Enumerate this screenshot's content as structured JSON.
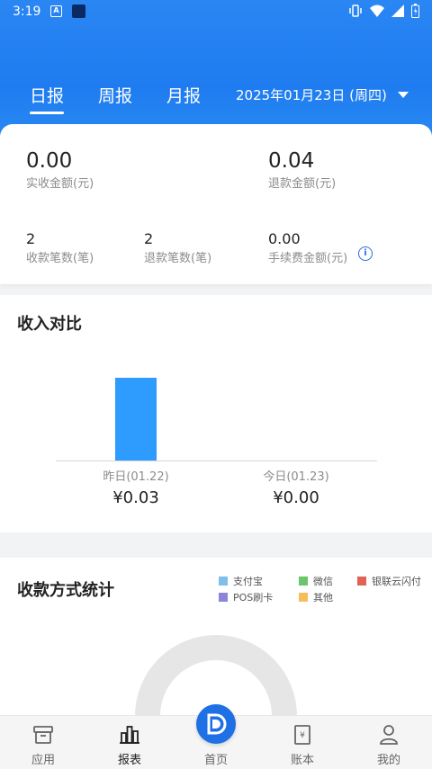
{
  "status": {
    "time": "3:19"
  },
  "tabs": [
    {
      "label": "日报",
      "active": true
    },
    {
      "label": "周报",
      "active": false
    },
    {
      "label": "月报",
      "active": false
    }
  ],
  "date": "2025年01月23日 (周四)",
  "summary": {
    "received_amount": {
      "value": "0.00",
      "label": "实收金额(元)"
    },
    "refund_amount": {
      "value": "0.04",
      "label": "退款金额(元)"
    },
    "received_count": {
      "value": "2",
      "label": "收款笔数(笔)"
    },
    "refund_count": {
      "value": "2",
      "label": "退款笔数(笔)"
    },
    "fee_amount": {
      "value": "0.00",
      "label": "手续费金额(元)"
    }
  },
  "income_compare": {
    "title": "收入对比",
    "yesterday": {
      "label": "昨日(01.22)",
      "amount": "¥0.03"
    },
    "today": {
      "label": "今日(01.23)",
      "amount": "¥0.00"
    }
  },
  "chart_data": {
    "type": "bar",
    "categories": [
      "昨日(01.22)",
      "今日(01.23)"
    ],
    "values": [
      0.03,
      0.0
    ]
  },
  "payment_stats": {
    "title": "收款方式统计",
    "legend": [
      {
        "name": "支付宝",
        "color": "#7fbfe9"
      },
      {
        "name": "微信",
        "color": "#6cc46c"
      },
      {
        "name": "银联云闪付",
        "color": "#e06356"
      },
      {
        "name": "POS刷卡",
        "color": "#8a85d8"
      },
      {
        "name": "其他",
        "color": "#f5be5b"
      }
    ]
  },
  "nav": [
    {
      "label": "应用",
      "icon": "app-box-icon"
    },
    {
      "label": "报表",
      "icon": "report-bars-icon"
    },
    {
      "label": "首页",
      "icon": "home-logo-icon"
    },
    {
      "label": "账本",
      "icon": "ledger-icon"
    },
    {
      "label": "我的",
      "icon": "user-icon"
    }
  ]
}
